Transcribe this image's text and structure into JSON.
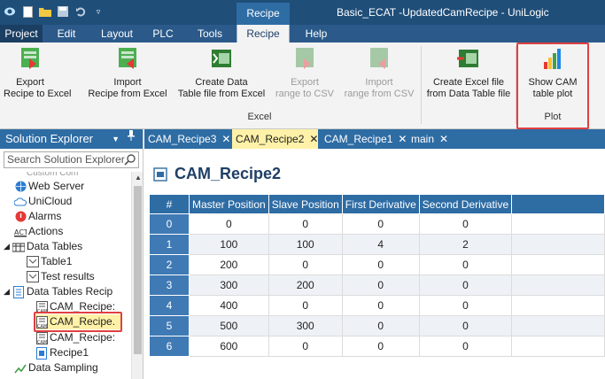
{
  "titlebar": {
    "context_tab": "Recipe",
    "window_title": "Basic_ECAT -UpdatedCamRecipe - UniLogic"
  },
  "menu": {
    "tabs": [
      "Project",
      "Edit",
      "Layout",
      "PLC",
      "Tools",
      "Recipe",
      "Help"
    ]
  },
  "ribbon": {
    "export_recipe": [
      "Export",
      "Recipe to Excel"
    ],
    "import_recipe": [
      "Import",
      "Recipe from Excel"
    ],
    "create_data_table": [
      "Create Data",
      "Table file from Excel"
    ],
    "export_range": [
      "Export",
      "range to CSV"
    ],
    "import_range": [
      "Import",
      "range from CSV"
    ],
    "create_excel": [
      "Create Excel file",
      "from Data Table file"
    ],
    "show_cam": [
      "Show CAM",
      "table plot"
    ],
    "group_excel": "Excel",
    "group_plot": "Plot"
  },
  "solution_explorer": {
    "title": "Solution Explorer",
    "search_placeholder": "Search Solution Explorer",
    "items": [
      "Web Server",
      "UniCloud",
      "Alarms",
      "Actions",
      "Data Tables",
      "Table1",
      "Test results",
      "Data Tables Recip",
      "CAM_Recipe:",
      "CAM_Recipe.",
      "CAM_Recipe:",
      "Recipe1",
      "Data Sampling"
    ]
  },
  "doc_tabs": [
    "CAM_Recipe3",
    "CAM_Recipe2",
    "CAM_Recipe1",
    "main"
  ],
  "recipe": {
    "title": "CAM_Recipe2",
    "columns": [
      "#",
      "Master Position",
      "Slave Position",
      "First Derivative",
      "Second Derivative"
    ],
    "rows": [
      [
        "0",
        "0",
        "0",
        "0",
        "0"
      ],
      [
        "1",
        "100",
        "100",
        "4",
        "2"
      ],
      [
        "2",
        "200",
        "0",
        "0",
        "0"
      ],
      [
        "3",
        "300",
        "200",
        "0",
        "0"
      ],
      [
        "4",
        "400",
        "0",
        "0",
        "0"
      ],
      [
        "5",
        "500",
        "300",
        "0",
        "0"
      ],
      [
        "6",
        "600",
        "0",
        "0",
        "0"
      ]
    ]
  },
  "colors": {
    "title_bar": "#1f4e79",
    "ribbon_tab_active": "#f3f3f3",
    "header_blue": "#2e6ca4",
    "active_doc_tab": "#fff2a8",
    "highlight_red": "#e04040"
  }
}
